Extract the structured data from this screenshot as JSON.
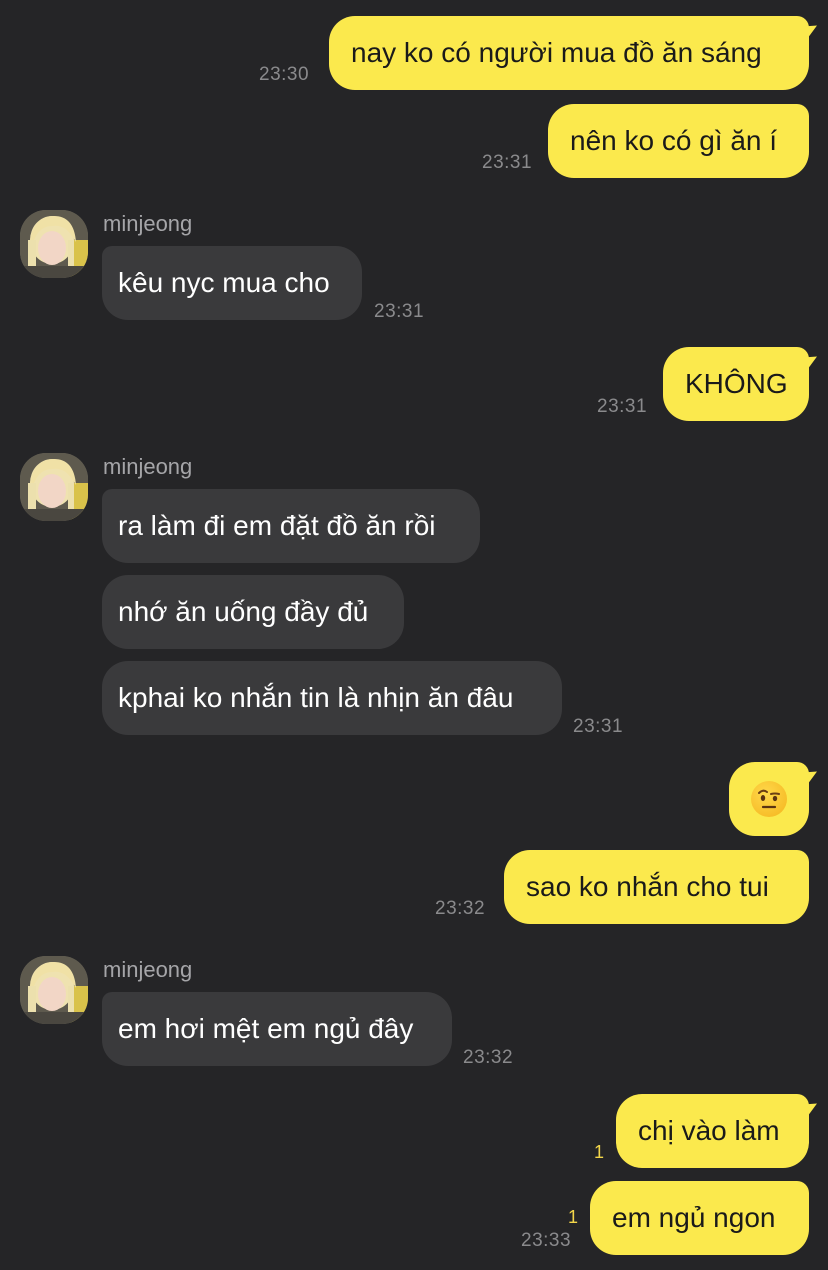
{
  "contact": {
    "name": "minjeong"
  },
  "messages": {
    "m1": {
      "text": "nay ko có người mua đồ ăn sáng",
      "time": "23:30"
    },
    "m2": {
      "text": "nên ko có gì ăn í",
      "time": "23:31"
    },
    "m3": {
      "sender": "minjeong",
      "text": "kêu nyc mua cho",
      "time": "23:31"
    },
    "m4": {
      "text": "KHÔNG",
      "time": "23:31"
    },
    "m5": {
      "sender": "minjeong",
      "text": "ra làm đi em đặt đồ ăn rồi"
    },
    "m6": {
      "text": "nhớ ăn uống đầy đủ"
    },
    "m7": {
      "text": "kphai ko nhắn tin là nhịn ăn đâu",
      "time": "23:31"
    },
    "m8": {
      "emoji": "face-with-raised-eyebrow"
    },
    "m9": {
      "text": "sao ko nhắn cho tui",
      "time": "23:32"
    },
    "m10": {
      "sender": "minjeong",
      "text": "em hơi mệt em ngủ đây",
      "time": "23:32"
    },
    "m11": {
      "text": "chị vào làm",
      "unread": "1"
    },
    "m12": {
      "text": "em ngủ ngon",
      "unread": "1",
      "time": "23:33"
    }
  },
  "colors": {
    "background": "#252527",
    "outgoing_bubble": "#fbe94d",
    "incoming_bubble": "#3a3a3c",
    "unread_count": "#f3d64a"
  }
}
